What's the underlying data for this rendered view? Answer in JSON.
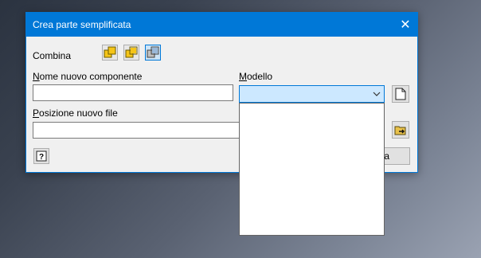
{
  "window": {
    "title": "Crea parte semplificata",
    "close_symbol": "✕"
  },
  "combine": {
    "label": "Combina",
    "options": [
      {
        "icon": "combine-merge-icon",
        "selected": false
      },
      {
        "icon": "combine-merge-outline-icon",
        "selected": false
      },
      {
        "icon": "combine-separate-icon",
        "selected": true
      }
    ]
  },
  "component_name": {
    "label_accel": "N",
    "label_rest": "ome nuovo componente",
    "value": ""
  },
  "template": {
    "label_accel": "M",
    "label_rest": "odello",
    "selected": "",
    "dropdown_open": true,
    "browse_icon": "new-document-icon"
  },
  "file_location": {
    "label_accel": "P",
    "label_rest": "osizione nuovo file",
    "value": "",
    "browse_icon": "folder-browse-icon"
  },
  "buttons": {
    "help_icon": "help-icon",
    "cancel_visible_text": "lla"
  }
}
